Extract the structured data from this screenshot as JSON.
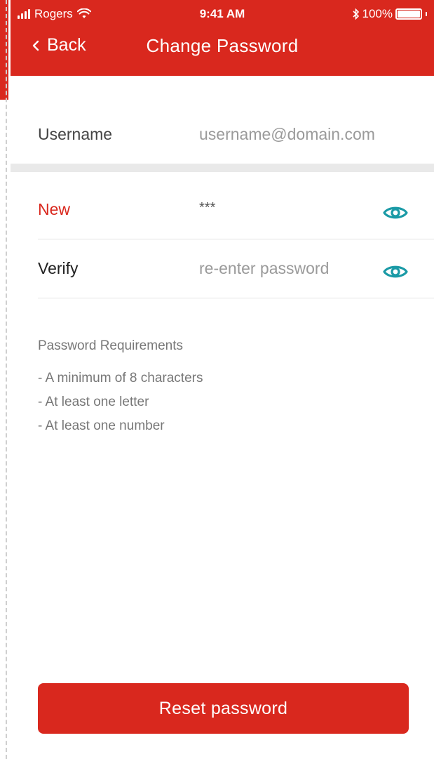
{
  "status_bar": {
    "carrier": "Rogers",
    "time": "9:41 AM",
    "battery_percent_text": "100%",
    "battery_level": 1.0
  },
  "nav": {
    "back_label": "Back",
    "title": "Change Password"
  },
  "form": {
    "username_label": "Username",
    "username_value": "username@domain.com",
    "new_label": "New",
    "new_value": "***",
    "verify_label": "Verify",
    "verify_placeholder": "re-enter password"
  },
  "requirements": {
    "title": "Password Requirements",
    "items": [
      "- A minimum of 8 characters",
      "- At least one letter",
      "- At least one number"
    ]
  },
  "actions": {
    "reset_label": "Reset password"
  },
  "colors": {
    "brand_red": "#d9281e",
    "eye_teal": "#1a9aa6"
  },
  "icons": {
    "signal": "signal-icon",
    "wifi": "wifi-icon",
    "bluetooth": "bluetooth-icon",
    "battery": "battery-icon",
    "back": "chevron-left-icon",
    "show_password": "eye-icon"
  }
}
